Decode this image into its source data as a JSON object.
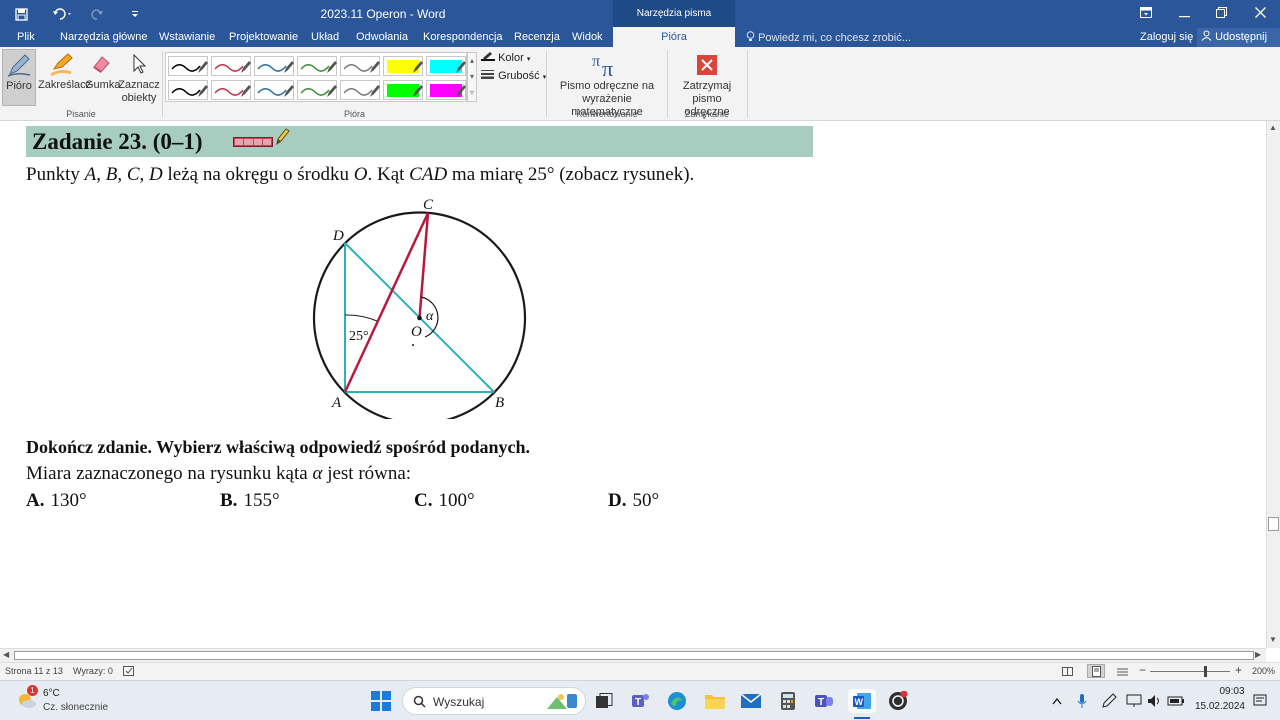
{
  "window": {
    "title": "2023.11 Operon - Word",
    "context_tool": "Narzędzia pisma odręcznego"
  },
  "tabs": [
    "Plik",
    "Narzędzia główne",
    "Wstawianie",
    "Projektowanie",
    "Układ",
    "Odwołania",
    "Korespondencja",
    "Recenzja",
    "Widok"
  ],
  "active_tab": "Pióra",
  "tellme_placeholder": "Powiedz mi, co chcesz zrobić...",
  "signin_label": "Zaloguj się",
  "share_label": "Udostępnij",
  "ribbon": {
    "tools": {
      "pen": "Pióro",
      "highlighter": "Zakreślacz",
      "eraser": "Gumka",
      "select": "Zaznacz obiekty"
    },
    "groups": {
      "writing": "Pisanie",
      "pens": "Pióra",
      "convert": "Konwertowanie",
      "close": "Zamykanie"
    },
    "color_label": "Kolor",
    "thickness_label": "Grubość",
    "math_label": "Pismo odręczne na wyrażenie matematyczne",
    "stop_label": "Zatrzymaj pismo odręczne",
    "pen_colors": [
      "#000000",
      "#c0304a",
      "#2d6f9e",
      "#3a8f3a",
      "#7a7a7a",
      "#ffff00",
      "#00ffff",
      "#000000",
      "#c0304a",
      "#2d6f9e",
      "#3a8f3a",
      "#7a7a7a",
      "#00ff00",
      "#ff00ff"
    ]
  },
  "document": {
    "task_title": "Zadanie 23. (0–1)",
    "intro_plain_1": "Punkty ",
    "intro_points": "A",
    "intro_sep1": ", ",
    "intro_B": "B",
    "intro_sep2": ", ",
    "intro_C": "C",
    "intro_sep3": ", ",
    "intro_D": "D",
    "intro_plain_2": " leżą na okręgu o środku ",
    "intro_O": "O",
    "intro_plain_3": ". Kąt ",
    "intro_CAD": "CAD",
    "intro_plain_4": " ma miarę 25° (zobacz rysunek).",
    "figure": {
      "label_A": "A",
      "label_B": "B",
      "label_C": "C",
      "label_D": "D",
      "label_O": "O",
      "label_alpha": "α",
      "label_angle": "25°"
    },
    "instruction": "Dokończ zdanie. Wybierz właściwą odpowiedź spośród podanych.",
    "question_1": "Miara zaznaczonego na rysunku kąta ",
    "question_alpha": "α",
    "question_2": " jest równa:",
    "answers": [
      {
        "letter": "A.",
        "value": "130°"
      },
      {
        "letter": "B.",
        "value": "155°"
      },
      {
        "letter": "C.",
        "value": "100°"
      },
      {
        "letter": "D.",
        "value": "50°"
      }
    ]
  },
  "status": {
    "page": "Strona 11 z 13",
    "words": "Wyrazy: 0",
    "zoom": "200%",
    "zoom_level": 0.69
  },
  "taskbar": {
    "weather_temp": "6°C",
    "weather_desc": "Cz. słonecznie",
    "weather_badge": "1",
    "search_label": "Wyszukaj",
    "time": "09:03",
    "date": "15.02.2024"
  }
}
